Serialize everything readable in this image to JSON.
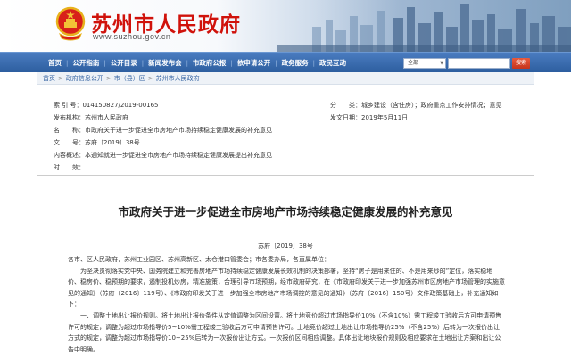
{
  "header": {
    "title": "苏州市人民政府",
    "url": "www.suzhou.gov.cn"
  },
  "nav": {
    "items": [
      "首页",
      "公开指南",
      "公开目录",
      "新闻发布会",
      "市政府公报",
      "依申请公开",
      "政务服务",
      "政民互动"
    ],
    "search_scope": "全部",
    "search_button": "搜索"
  },
  "breadcrumb": [
    "首页",
    "政府信息公开",
    "市（县）区",
    "苏州市人民政府"
  ],
  "meta": {
    "index_label": "索 引 号：",
    "index_value": "014150827/2019-00165",
    "publisher_label": "发布机构：",
    "publisher_value": "苏州市人民政府",
    "name_label": "名　　称：",
    "name_value": "市政府关于进一步促进全市房地产市场持续稳定健康发展的补充意见",
    "docno_label": "文　　号：",
    "docno_value": "苏府〔2019〕38号",
    "summary_label": "内容概述：",
    "summary_value": "本通知就进一步促进全市房地产市场持续稳定健康发展提出补充意见",
    "validity_label": "时　　效：",
    "validity_value": "",
    "category_label": "分　　类：",
    "category_value": "城乡建设（含住房）；政府重点工作安排情况；意见",
    "date_label": "发文日期：",
    "date_value": "2019年5月11日"
  },
  "article": {
    "title": "市政府关于进一步促进全市房地产市场持续稳定健康发展的补充意见",
    "doc_no": "苏府〔2019〕38号",
    "recipients": "各市、区人民政府，苏州工业园区、苏州高新区、太仓港口管委会；市各委办局，各直属单位：",
    "para1": "为坚决贯彻落实党中央、国务院建立和完善房地产市场持续稳定健康发展长效机制的决策部署，坚持“房子是用来住的、不是用来炒的”定位，落实稳地价、稳房价、稳预期的要求，遏制投机炒房，精准施策，合理引导市场预期，经市政府研究，在《市政府印发关于进一步加强苏州市区房地产市场管理的实施意见的通知》（苏府〔2016〕119号）、《市政府印发关于进一步加强全市房地产市场调控的意见的通知》（苏府〔2016〕150号）文件政策基础上，补充通知如下：",
    "para2": "一、调整土地出让报价规则。将土地出让报价条件从定值调整为区间设置。将土地竞价超过市场指导价10%（不含10%）需工程竣工验收后方可申请预售许可的规定，调整为超过市场指导价5~10%需工程竣工验收后方可申请预售许可。土地竞价超过土地出让市场指导价25%（不含25%）后转为一次报价出让方式的规定，调整为超过市场指导价10~25%后转为一次报价出让方式。一次报价区间相应调整。具体出让地块报价规则及相应要求在土地出让方案和出让公告中明确。"
  }
}
